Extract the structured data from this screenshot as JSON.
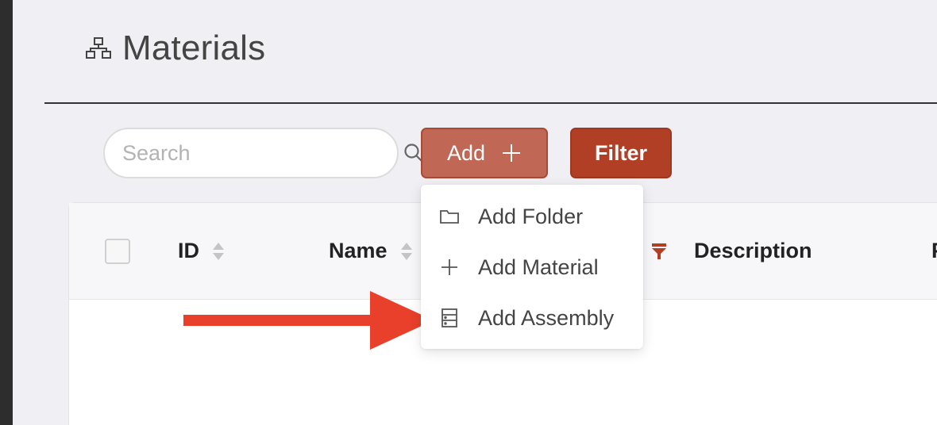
{
  "page": {
    "title": "Materials",
    "title_icon": "hierarchy-icon"
  },
  "search": {
    "placeholder": "Search",
    "value": ""
  },
  "toolbar": {
    "add_label": "Add",
    "filter_label": "Filter"
  },
  "table": {
    "columns": [
      {
        "label": "ID",
        "sortable": true
      },
      {
        "label": "Name",
        "sortable": true
      },
      {
        "label": "Description",
        "sortable": false
      },
      {
        "label": "P",
        "sortable": false
      }
    ]
  },
  "add_menu": {
    "items": [
      {
        "label": "Add Folder",
        "icon": "folder-icon"
      },
      {
        "label": "Add Material",
        "icon": "plus-icon"
      },
      {
        "label": "Add Assembly",
        "icon": "assembly-icon"
      }
    ]
  },
  "colors": {
    "add_button": "#c06855",
    "filter_button": "#b03f25",
    "annotation_arrow": "#e8402a"
  }
}
